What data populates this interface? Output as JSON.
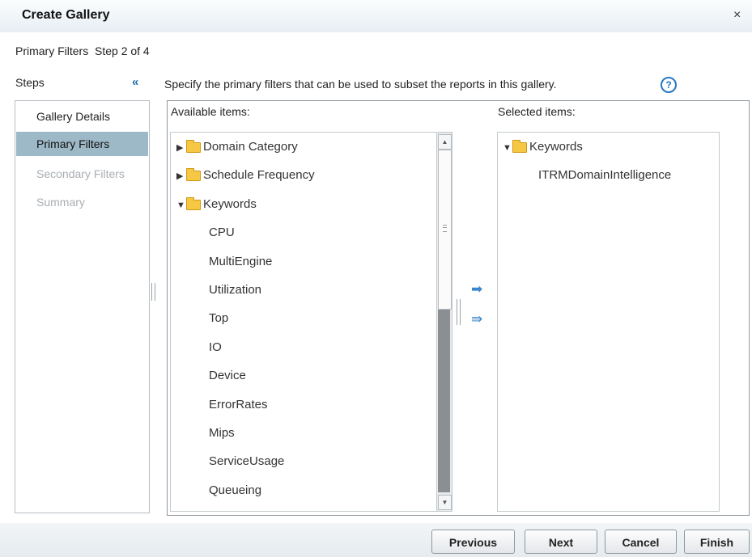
{
  "dialog": {
    "title": "Create Gallery",
    "close_label": "×",
    "subtitle": "Primary Filters  Step 2 of 4"
  },
  "steps": {
    "heading": "Steps",
    "collapse_label": "«",
    "items": [
      {
        "label": "Gallery Details",
        "state": "normal"
      },
      {
        "label": "Primary Filters",
        "state": "active"
      },
      {
        "label": "Secondary Filters",
        "state": "disabled"
      },
      {
        "label": "Summary",
        "state": "disabled"
      }
    ]
  },
  "instructions": "Specify the primary filters that can be used to subset the reports in this gallery.",
  "help_label": "?",
  "available": {
    "label": "Available items:",
    "items": [
      {
        "label": "Domain Category",
        "type": "folder",
        "expanded": false
      },
      {
        "label": "Schedule Frequency",
        "type": "folder",
        "expanded": false
      },
      {
        "label": "Keywords",
        "type": "folder",
        "expanded": true
      },
      {
        "label": "CPU",
        "type": "leaf"
      },
      {
        "label": "MultiEngine",
        "type": "leaf"
      },
      {
        "label": "Utilization",
        "type": "leaf"
      },
      {
        "label": "Top",
        "type": "leaf"
      },
      {
        "label": "IO",
        "type": "leaf"
      },
      {
        "label": "Device",
        "type": "leaf"
      },
      {
        "label": "ErrorRates",
        "type": "leaf"
      },
      {
        "label": "Mips",
        "type": "leaf"
      },
      {
        "label": "ServiceUsage",
        "type": "leaf"
      },
      {
        "label": "Queueing",
        "type": "leaf"
      }
    ]
  },
  "transfer": {
    "add_icon": "➡",
    "add_all_icon": "⇛"
  },
  "selected": {
    "label": "Selected items:",
    "items": [
      {
        "label": "Keywords",
        "type": "folder",
        "expanded": true
      },
      {
        "label": "ITRMDomainIntelligence",
        "type": "leaf"
      }
    ]
  },
  "buttons": {
    "previous": "Previous",
    "next": "Next",
    "cancel": "Cancel",
    "finish": "Finish"
  }
}
